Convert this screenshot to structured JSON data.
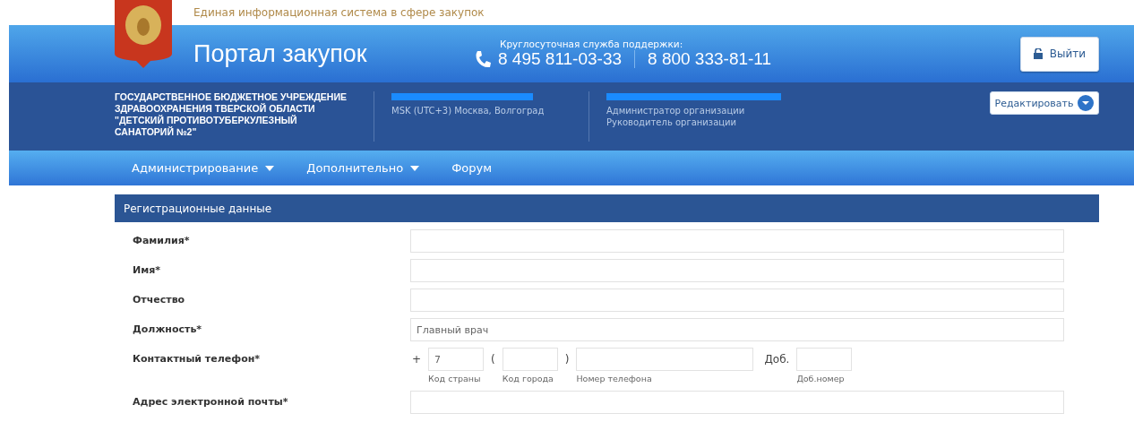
{
  "site_tagline": "Единая информационная система в сфере закупок",
  "portal_title": "Портал закупок",
  "support": {
    "label": "Круглосуточная служба поддержки:",
    "phones": [
      "8 495 811-03-33",
      "8 800 333-81-11"
    ]
  },
  "logout_button": "Выйти",
  "organization": {
    "name": "ГОСУДАРСТВЕННОЕ БЮДЖЕТНОЕ УЧРЕЖДЕНИЕ\nЗДРАВООХРАНЕНИЯ ТВЕРСКОЙ ОБЛАСТИ\n\"ДЕТСКИЙ ПРОТИВОТУБЕРКУЛЕЗНЫЙ\nСАНАТОРИЙ №2\"",
    "timezone": "MSK (UTC+3) Москва, Волгоград",
    "roles": [
      "Администратор организации",
      "Руководитель организации"
    ]
  },
  "edit_button": "Редактировать",
  "nav": [
    {
      "label": "Администрирование",
      "dropdown": true
    },
    {
      "label": "Дополнительно",
      "dropdown": true
    },
    {
      "label": "Форум",
      "dropdown": false
    }
  ],
  "section_title": "Регистрационные данные",
  "fields": [
    {
      "kind": "text",
      "label": "Фамилия*"
    },
    {
      "kind": "text",
      "label": "Имя*"
    },
    {
      "kind": "text",
      "label": "Отчество"
    },
    {
      "kind": "text",
      "label": "Должность*",
      "value": "Главный врач"
    },
    {
      "kind": "phone",
      "label": "Контактный телефон*",
      "plus": "+",
      "country_code": {
        "value": "7",
        "caption": "Код страны"
      },
      "open_paren": "(",
      "city_code": {
        "caption": "Код города"
      },
      "close_paren": ")",
      "number": {
        "caption": "Номер телефона"
      },
      "extension": {
        "label": "Доб.",
        "caption": "Доб.номер"
      }
    },
    {
      "kind": "text",
      "label": "Адрес электронной почты*"
    }
  ]
}
